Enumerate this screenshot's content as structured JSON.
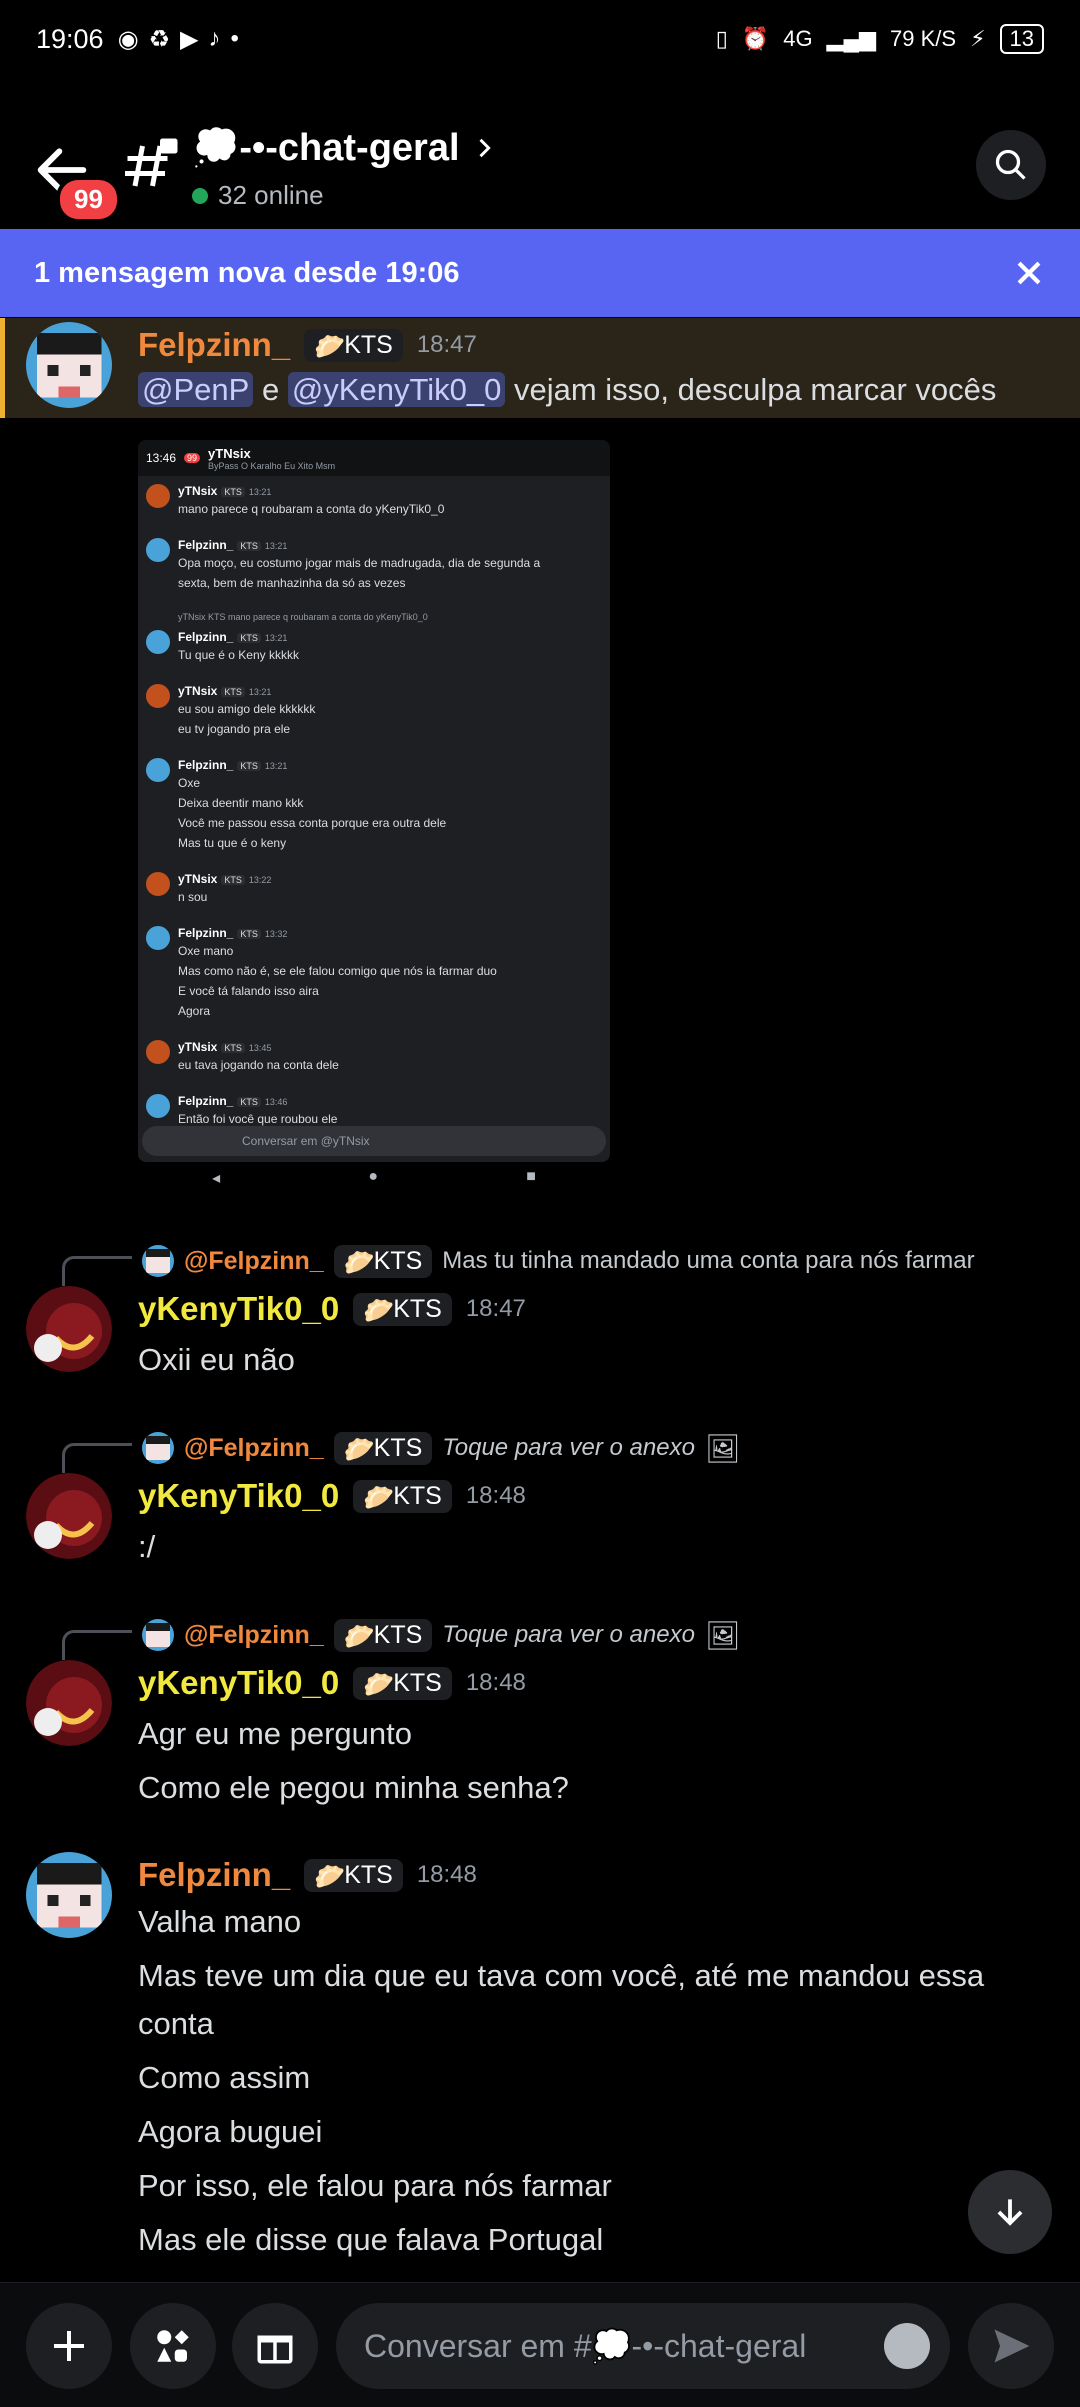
{
  "status_bar": {
    "time": "19:06",
    "network": "4G",
    "speed": "79 K/S",
    "battery": "13"
  },
  "header": {
    "badge": "99",
    "channel_name": "💭-•-chat-geral",
    "online": "32 online"
  },
  "banner": {
    "text": "1 mensagem nova desde 19:06"
  },
  "messages": [
    {
      "author": "Felpzinn_",
      "tag": "KTS",
      "time": "18:47",
      "mentions": [
        "@PenP",
        "@yKenyTik0_0"
      ],
      "conj": "e",
      "text": "vejam isso, desculpa marcar vocês"
    },
    {
      "reply_to": "@Felpzinn_",
      "reply_tag": "KTS",
      "reply_text": "Mas tu tinha mandado uma conta para nós farmar",
      "author": "yKenyTik0_0",
      "tag": "KTS",
      "time": "18:47",
      "lines": [
        "Oxii eu não"
      ]
    },
    {
      "reply_to": "@Felpzinn_",
      "reply_tag": "KTS",
      "reply_text": "Toque para ver o anexo",
      "author": "yKenyTik0_0",
      "tag": "KTS",
      "time": "18:48",
      "lines": [
        ":/"
      ]
    },
    {
      "reply_to": "@Felpzinn_",
      "reply_tag": "KTS",
      "reply_text": "Toque para ver o anexo",
      "author": "yKenyTik0_0",
      "tag": "KTS",
      "time": "18:48",
      "lines": [
        "Agr eu me pergunto",
        "Como ele pegou minha senha?"
      ]
    },
    {
      "author": "Felpzinn_",
      "tag": "KTS",
      "time": "18:48",
      "lines": [
        "Valha mano",
        "Mas teve um dia que eu tava com você, até me mandou essa",
        "conta",
        "Como assim",
        "Agora buguei",
        "Por isso, ele falou para nós farmar",
        "Mas ele disse que falava Portugal"
      ]
    }
  ],
  "attachment": {
    "status_time": "13:46",
    "title": "yTNsix",
    "subtitle": "ByPass O Karalho Eu Xito Msm",
    "badge": "99",
    "rows": [
      {
        "author": "yTNsix",
        "time": "13:21",
        "lines": [
          "mano parece q roubaram a conta do yKenyTik0_0"
        ]
      },
      {
        "author": "Felpzinn_",
        "time": "13:21",
        "lines": [
          "Opa moço, eu costumo jogar mais de madrugada, dia de segunda a",
          "sexta, bem de manhazinha da só as vezes"
        ]
      },
      {
        "author": "Felpzinn_",
        "time": "13:21",
        "reply": "yTNsix  KTS  mano parece q roubaram a conta do yKenyTik0_0",
        "lines": [
          "Tu que é o Keny kkkkk"
        ]
      },
      {
        "author": "yTNsix",
        "time": "13:21",
        "lines": [
          "eu sou amigo dele kkkkkk",
          "eu tv jogando pra ele"
        ]
      },
      {
        "author": "Felpzinn_",
        "time": "13:21",
        "lines": [
          "Oxe",
          "Deixa deentir mano kkk",
          "Você me passou essa conta porque era outra dele",
          "Mas tu que é o keny"
        ]
      },
      {
        "author": "yTNsix",
        "time": "13:22",
        "lines": [
          "n sou"
        ]
      },
      {
        "author": "Felpzinn_",
        "time": "13:32",
        "lines": [
          "Oxe mano",
          "Mas como não é, se ele falou comigo que nós ia farmar duo",
          "E você tá falando isso aira",
          "Agora"
        ]
      },
      {
        "author": "yTNsix",
        "time": "13:45",
        "lines": [
          "eu tava jogando na conta dele"
        ]
      },
      {
        "author": "Felpzinn_",
        "time": "13:46",
        "lines": [
          "Então foi você que roubou ele"
        ]
      }
    ],
    "input_placeholder": "Conversar em @yTNsix"
  },
  "composer": {
    "placeholder": "Conversar em #💭-•-chat-geral"
  },
  "colors": {
    "accent": "#5865f2",
    "felp": "#f0883e",
    "keny": "#f1e93f",
    "mention_bg": "#3c4270"
  }
}
